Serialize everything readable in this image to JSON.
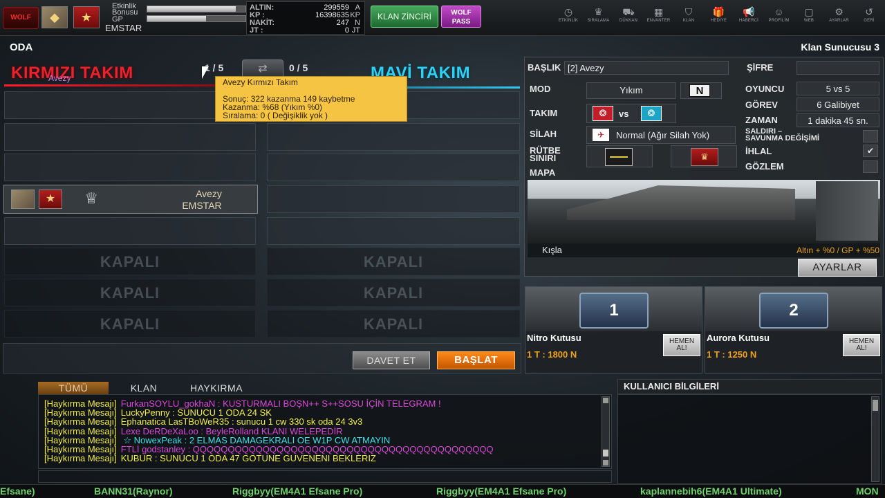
{
  "topbar": {
    "logo": "WOLF",
    "player": {
      "bonus_label_1": "Etkinlik",
      "bonus_label_2": "Bonusu",
      "bonus_fill": 0.9,
      "gp_label": "GP",
      "gp_fill": 0.6,
      "name": "EMSTAR"
    },
    "currency": [
      {
        "key": "ALTIN:",
        "value": "299559",
        "unit": "A"
      },
      {
        "key": "KP :",
        "value": "16398635",
        "unit": "KP"
      },
      {
        "key": "NAKİT:",
        "value": "247",
        "unit": "N"
      },
      {
        "key": "JT   :",
        "value": "0",
        "unit": "JT"
      }
    ],
    "klan_button": "KLAN ZİNCİRİ",
    "wolf_pass_1": "WOLF",
    "wolf_pass_2": "PASS",
    "nav": [
      {
        "icon": "clock-icon",
        "glyph": "◷",
        "label": "ETKİNLİK"
      },
      {
        "icon": "trophy-icon",
        "glyph": "♛",
        "label": "SIRALAMA"
      },
      {
        "icon": "cart-icon",
        "glyph": "⛟",
        "label": "DÜKKAN"
      },
      {
        "icon": "inventory-icon",
        "glyph": "▦",
        "label": "ENVANTER"
      },
      {
        "icon": "clan-icon",
        "glyph": "⛉",
        "label": "KLAN"
      },
      {
        "icon": "gift-icon",
        "glyph": "🎁",
        "label": "HEDİYE"
      },
      {
        "icon": "megaphone-icon",
        "glyph": "📢",
        "label": "HABERCİ"
      },
      {
        "icon": "profile-icon",
        "glyph": "☺",
        "label": "PROFİLİM"
      },
      {
        "icon": "web-icon",
        "glyph": "▢",
        "label": "WEB"
      },
      {
        "icon": "settings-icon",
        "glyph": "⚙",
        "label": "AYARLAR"
      },
      {
        "icon": "back-icon",
        "glyph": "↺",
        "label": "GERİ"
      }
    ]
  },
  "room": {
    "title": "ODA",
    "server": "Klan Sunucusu 3",
    "red_team": "KIRMIZI TAKIM",
    "blue_team": "MAVİ TAKIM",
    "red_count": "1 / 5",
    "blue_count": "0 / 5",
    "overlay_name": "Avezy",
    "player_slot": {
      "line1": "Avezy",
      "line2": "EMSTAR"
    },
    "closed_label": "KAPALI",
    "tooltip": {
      "line1": "Avezy   Kırmızı Takım",
      "line2": "Sonuç: 322 kazanma 149 kaybetme",
      "line3": "Kazanma: %68 (Yıkım %0)",
      "line4": "Sıralama: 0 ( Değişiklik yok )"
    },
    "invite_button": "DAVET ET",
    "start_button": "BAŞLAT"
  },
  "settings": {
    "title_label": "BAŞLIK",
    "title_value": "[2] Avezy",
    "password_label": "ŞİFRE",
    "mode_label": "MOD",
    "mode_value": "Yıkım",
    "mode_badge": "N",
    "team_label": "TAKIM",
    "vs": "vs",
    "weapon_label": "SİLAH",
    "weapon_value": "Normal (Ağır Silah Yok)",
    "rank_label_1": "RÜTBE",
    "rank_label_2": "SINIRI",
    "map_label": "MAPA",
    "player_label": "OYUNCU",
    "player_value": "5 vs 5",
    "mission_label": "GÖREV",
    "mission_value": "6 Galibiyet",
    "time_label": "ZAMAN",
    "time_value": "1 dakika 45 sn.",
    "attack_label_1": "SALDIRI –",
    "attack_label_2": "SAVUNMA DEĞİŞİMİ",
    "violation_label": "İHLAL",
    "violation_checked": "✔",
    "observe_label": "GÖZLEM",
    "map_name": "Kışla",
    "map_bonus": "Altın + %0 / GP + %50",
    "settings_button": "AYARLAR"
  },
  "boxes": [
    {
      "name": "Nitro Kutusu",
      "price": "1 T : 1800 N",
      "num": "1",
      "buy_1": "HEMEN",
      "buy_2": "AL!"
    },
    {
      "name": "Aurora Kutusu",
      "price": "1 T : 1250 N",
      "num": "2",
      "buy_1": "HEMEN",
      "buy_2": "AL!"
    }
  ],
  "chat": {
    "tabs": [
      "TÜMÜ",
      "KLAN",
      "HAYKIRMA"
    ],
    "lines": [
      {
        "prefix": "[Haykırma Mesajı]",
        "text": "FurkanSOYLU_gokhaN : KUSTURMALI BOŞN++ S++SOSU İÇİN TELEGRAM !",
        "color": "#d848d8"
      },
      {
        "prefix": "[Haykırma Mesajı]",
        "text": "LuckyPenny : SUNUCU 1 ODA 24 SK",
        "color": "#f2ee4a"
      },
      {
        "prefix": "[Haykırma Mesajı]",
        "text": "Ephanatica LasTBoWeR35 : sunucu 1 cw 330 sk oda 24 3v3",
        "color": "#f2ee4a"
      },
      {
        "prefix": "[Haykırma Mesajı]",
        "text": "Lexe DeRDeXaLoo : BeyleRolland KLANI WELEPEDİR",
        "color": "#d848d8"
      },
      {
        "prefix": "[Haykırma Mesajı]",
        "text": "         ☆         NowexPeak : 2 ELMAS DAMAGEKRALI OE W1P CW ATMAYIN",
        "color": "#3fe0e8"
      },
      {
        "prefix": "[Haykırma Mesajı]",
        "text": "FTLİ          godstanley : QQQQQQQQQQQQQQQQQQQQQQQQQQQQQQQQQQQQQQQQQQQ",
        "color": "#d848d8"
      },
      {
        "prefix": "[Haykırma Mesajı]",
        "text": "KUBUR : SUNUCU 1 ODA 47 GOTUNE GUVENENI BEKLERIZ",
        "color": "#f2ee4a"
      }
    ]
  },
  "user_info": {
    "title": "KULLANICI BİLGİLERİ"
  },
  "ticker": [
    "Efsane)",
    "BANN31(Raynor)",
    "Riggbyy(EM4A1 Efsane Pro)",
    "Riggbyy(EM4A1 Efsane Pro)",
    "kaplannebih6(EM4A1 Ultimate)",
    "MON"
  ]
}
